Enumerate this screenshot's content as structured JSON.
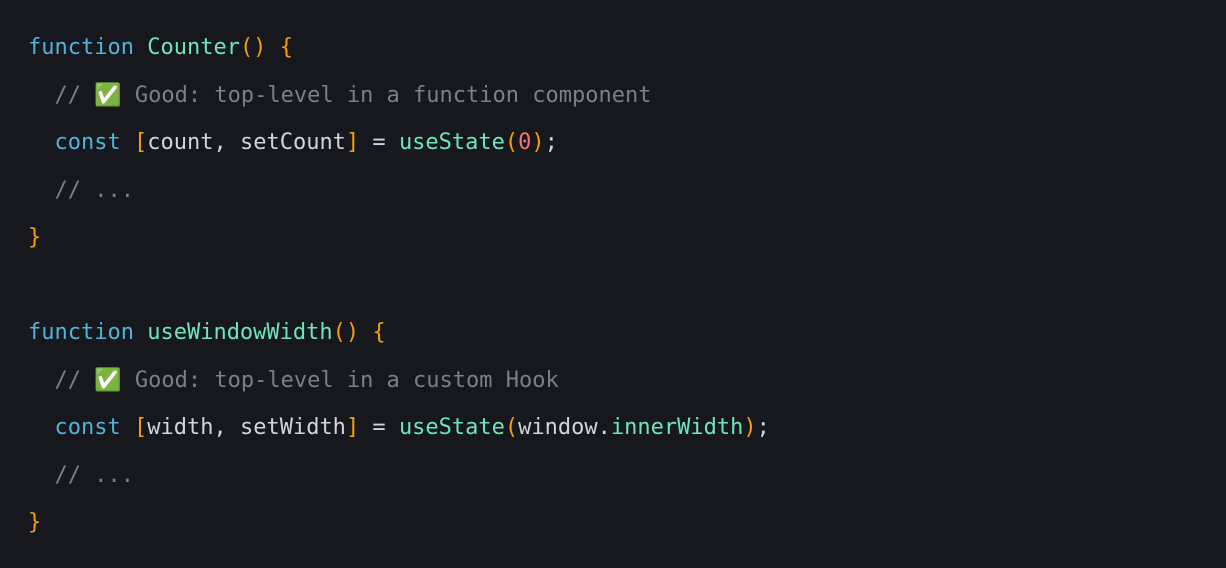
{
  "code": {
    "lines": [
      [
        {
          "cls": "tok-keyword",
          "text": "function"
        },
        {
          "cls": "tok-punct",
          "text": " "
        },
        {
          "cls": "tok-func",
          "text": "Counter"
        },
        {
          "cls": "tok-paren",
          "text": "()"
        },
        {
          "cls": "tok-punct",
          "text": " "
        },
        {
          "cls": "tok-bracket",
          "text": "{"
        }
      ],
      [
        {
          "cls": "tok-punct",
          "text": "  "
        },
        {
          "cls": "tok-comment",
          "text": "// "
        },
        {
          "cls": "emoji",
          "text": "✅"
        },
        {
          "cls": "tok-comment",
          "text": " Good: top-level in a function component"
        }
      ],
      [
        {
          "cls": "tok-punct",
          "text": "  "
        },
        {
          "cls": "tok-keyword",
          "text": "const"
        },
        {
          "cls": "tok-punct",
          "text": " "
        },
        {
          "cls": "tok-bracket",
          "text": "["
        },
        {
          "cls": "tok-ident",
          "text": "count"
        },
        {
          "cls": "tok-punct",
          "text": ", "
        },
        {
          "cls": "tok-ident",
          "text": "setCount"
        },
        {
          "cls": "tok-bracket",
          "text": "]"
        },
        {
          "cls": "tok-punct",
          "text": " = "
        },
        {
          "cls": "tok-func",
          "text": "useState"
        },
        {
          "cls": "tok-paren",
          "text": "("
        },
        {
          "cls": "tok-number",
          "text": "0"
        },
        {
          "cls": "tok-paren",
          "text": ")"
        },
        {
          "cls": "tok-punct",
          "text": ";"
        }
      ],
      [
        {
          "cls": "tok-punct",
          "text": "  "
        },
        {
          "cls": "tok-comment",
          "text": "// ..."
        }
      ],
      [
        {
          "cls": "tok-bracket",
          "text": "}"
        }
      ],
      [
        {
          "cls": "tok-punct",
          "text": ""
        }
      ],
      [
        {
          "cls": "tok-keyword",
          "text": "function"
        },
        {
          "cls": "tok-punct",
          "text": " "
        },
        {
          "cls": "tok-func",
          "text": "useWindowWidth"
        },
        {
          "cls": "tok-paren",
          "text": "()"
        },
        {
          "cls": "tok-punct",
          "text": " "
        },
        {
          "cls": "tok-bracket",
          "text": "{"
        }
      ],
      [
        {
          "cls": "tok-punct",
          "text": "  "
        },
        {
          "cls": "tok-comment",
          "text": "// "
        },
        {
          "cls": "emoji",
          "text": "✅"
        },
        {
          "cls": "tok-comment",
          "text": " Good: top-level in a custom Hook"
        }
      ],
      [
        {
          "cls": "tok-punct",
          "text": "  "
        },
        {
          "cls": "tok-keyword",
          "text": "const"
        },
        {
          "cls": "tok-punct",
          "text": " "
        },
        {
          "cls": "tok-bracket",
          "text": "["
        },
        {
          "cls": "tok-ident",
          "text": "width"
        },
        {
          "cls": "tok-punct",
          "text": ", "
        },
        {
          "cls": "tok-ident",
          "text": "setWidth"
        },
        {
          "cls": "tok-bracket",
          "text": "]"
        },
        {
          "cls": "tok-punct",
          "text": " = "
        },
        {
          "cls": "tok-func",
          "text": "useState"
        },
        {
          "cls": "tok-paren",
          "text": "("
        },
        {
          "cls": "tok-ident",
          "text": "window"
        },
        {
          "cls": "tok-punct",
          "text": "."
        },
        {
          "cls": "tok-prop",
          "text": "innerWidth"
        },
        {
          "cls": "tok-paren",
          "text": ")"
        },
        {
          "cls": "tok-punct",
          "text": ";"
        }
      ],
      [
        {
          "cls": "tok-punct",
          "text": "  "
        },
        {
          "cls": "tok-comment",
          "text": "// ..."
        }
      ],
      [
        {
          "cls": "tok-bracket",
          "text": "}"
        }
      ]
    ]
  }
}
